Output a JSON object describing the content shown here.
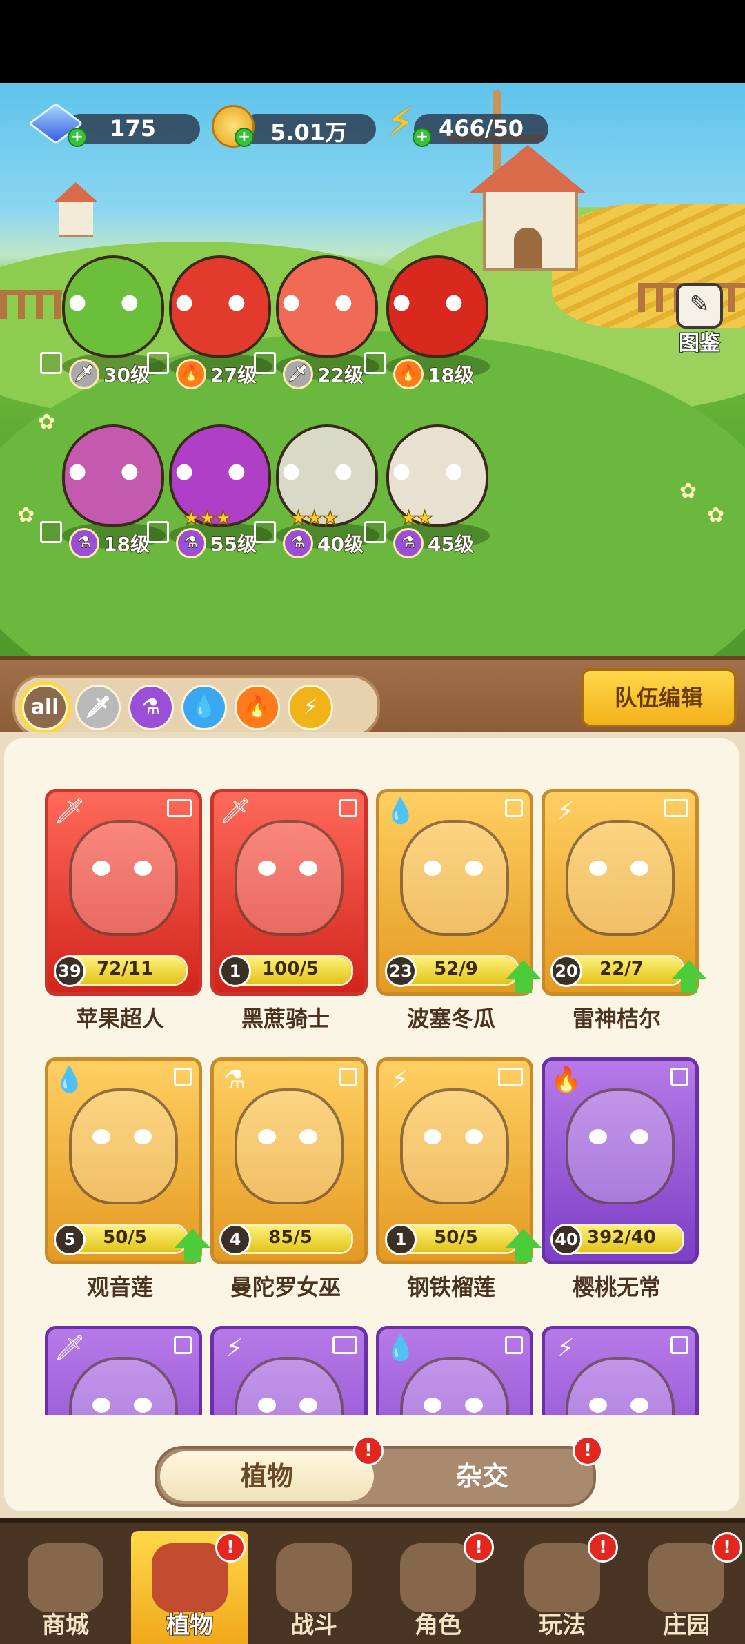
{
  "resources": {
    "gems": "175",
    "coins": "5.01万",
    "energy": "466/50"
  },
  "atlas_label": "图鉴",
  "team": [
    {
      "element": "sword",
      "level": "30级"
    },
    {
      "element": "fire",
      "level": "27级"
    },
    {
      "element": "sword",
      "level": "22级"
    },
    {
      "element": "fire",
      "level": "18级"
    },
    {
      "element": "poison",
      "level": "18级"
    },
    {
      "element": "poison",
      "level": "55级",
      "stars": "★★★"
    },
    {
      "element": "poison",
      "level": "40级",
      "stars": "★★★"
    },
    {
      "element": "poison",
      "level": "45级",
      "stars": "★★"
    }
  ],
  "filters": [
    {
      "label": "all",
      "icon": "all",
      "color": "#8a6a4a"
    },
    {
      "label": "",
      "icon": "sword-icon",
      "color": "#b9b9b9"
    },
    {
      "label": "",
      "icon": "poison-icon",
      "color": "#9a4fd6"
    },
    {
      "label": "",
      "icon": "water-icon",
      "color": "#3aa8f0"
    },
    {
      "label": "",
      "icon": "fire-icon",
      "color": "#ff7a1a"
    },
    {
      "label": "",
      "icon": "lightning-icon",
      "color": "#f0b41a"
    }
  ],
  "team_edit_label": "队伍编辑",
  "cards": [
    {
      "name": "苹果超人",
      "level": "39",
      "progress": "72/11",
      "fraction": 1.0,
      "theme": "red",
      "element": "sword",
      "upgrade": false
    },
    {
      "name": "黑蔗骑士",
      "level": "1",
      "progress": "100/5",
      "fraction": 1.0,
      "theme": "red",
      "element": "sword",
      "upgrade": false
    },
    {
      "name": "波塞冬瓜",
      "level": "23",
      "progress": "52/9",
      "fraction": 1.0,
      "theme": "gold",
      "element": "water",
      "upgrade": true
    },
    {
      "name": "雷神桔尔",
      "level": "20",
      "progress": "22/7",
      "fraction": 1.0,
      "theme": "gold",
      "element": "lightning",
      "upgrade": true
    },
    {
      "name": "观音莲",
      "level": "5",
      "progress": "50/5",
      "fraction": 1.0,
      "theme": "gold",
      "element": "water",
      "upgrade": true
    },
    {
      "name": "曼陀罗女巫",
      "level": "4",
      "progress": "85/5",
      "fraction": 1.0,
      "theme": "gold",
      "element": "poison",
      "upgrade": false
    },
    {
      "name": "钢铁榴莲",
      "level": "1",
      "progress": "50/5",
      "fraction": 1.0,
      "theme": "gold",
      "element": "lightning",
      "upgrade": true
    },
    {
      "name": "樱桃无常",
      "level": "40",
      "progress": "392/40",
      "fraction": 1.0,
      "theme": "purple",
      "element": "fire",
      "upgrade": false
    },
    {
      "name": "",
      "level": "",
      "progress": "",
      "fraction": 0,
      "theme": "purple",
      "element": "sword",
      "upgrade": false
    },
    {
      "name": "",
      "level": "",
      "progress": "",
      "fraction": 0,
      "theme": "purple",
      "element": "lightning",
      "upgrade": false
    },
    {
      "name": "",
      "level": "",
      "progress": "",
      "fraction": 0,
      "theme": "purple",
      "element": "water",
      "upgrade": false
    },
    {
      "name": "",
      "level": "",
      "progress": "",
      "fraction": 0,
      "theme": "purple",
      "element": "lightning",
      "upgrade": false
    }
  ],
  "toggle": {
    "plants": "植物",
    "hybrid": "杂交",
    "plants_badge": "!",
    "hybrid_badge": "!"
  },
  "nav": [
    {
      "label": "商城",
      "badge": ""
    },
    {
      "label": "植物",
      "badge": "!"
    },
    {
      "label": "战斗",
      "badge": ""
    },
    {
      "label": "角色",
      "badge": "!"
    },
    {
      "label": "玩法",
      "badge": "!"
    },
    {
      "label": "庄园",
      "badge": "!"
    }
  ]
}
